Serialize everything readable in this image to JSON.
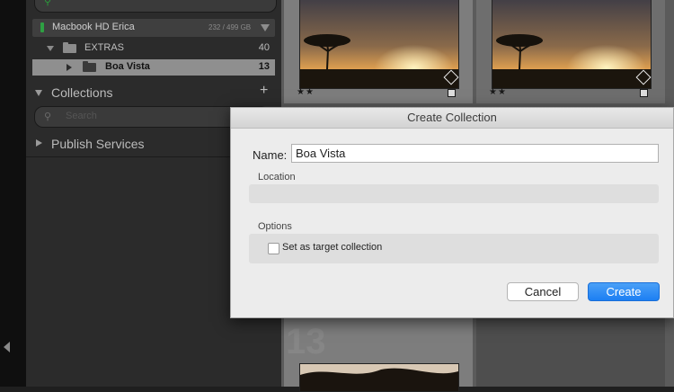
{
  "sidebar": {
    "top_search_icon": "search-icon",
    "volume": {
      "name": "Macbook HD Erica",
      "size": "232 / 499 GB"
    },
    "folders": [
      {
        "label": "EXTRAS",
        "count": "40"
      },
      {
        "label": "Boa Vista",
        "count": "13"
      }
    ],
    "collections": {
      "title": "Collections",
      "add": "+",
      "search_placeholder": "Search"
    },
    "publish": {
      "title": "Publish Services"
    }
  },
  "grid": {
    "cells": [
      {
        "stars": "★★"
      },
      {
        "stars": "★★"
      }
    ],
    "next_index": "13"
  },
  "dialog": {
    "title": "Create Collection",
    "name_label": "Name:",
    "name_value": "Boa Vista",
    "location_label": "Location",
    "options_label": "Options",
    "target_label": "Set as target collection",
    "cancel": "Cancel",
    "create": "Create"
  },
  "colors": {
    "accent": "#1c7ff3",
    "volume_led": "#2ea043",
    "selected_row": "#8f8f8f"
  }
}
